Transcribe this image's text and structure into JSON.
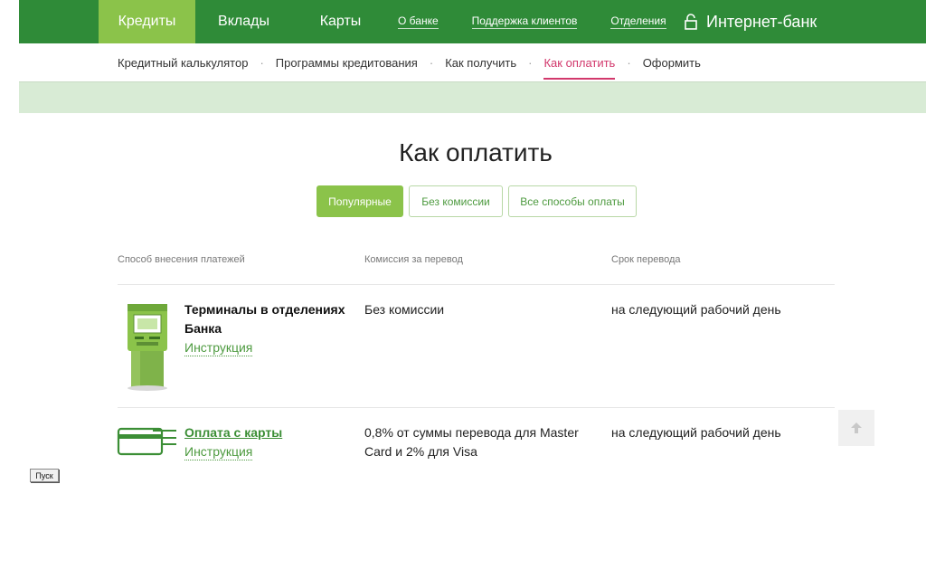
{
  "header": {
    "tabs": [
      {
        "label": "Кредиты",
        "active": true
      },
      {
        "label": "Вклады",
        "active": false
      },
      {
        "label": "Карты",
        "active": false
      }
    ],
    "links": [
      "О банке",
      "Поддержка клиентов",
      "Отделения"
    ],
    "internet_bank": "Интернет-банк",
    "bg_color": "#2f8b38",
    "accent": "#8bc34a"
  },
  "subnav": {
    "items": [
      "Кредитный калькулятор",
      "Программы кредитования",
      "Как получить",
      "Как оплатить",
      "Оформить"
    ],
    "separator": "·",
    "active_index": 3,
    "active_color": "#d2386c"
  },
  "page_title": "Как оплатить",
  "filters": [
    {
      "label": "Популярные",
      "active": true
    },
    {
      "label": "Без комиссии",
      "active": false
    },
    {
      "label": "Все способы оплаты",
      "active": false
    }
  ],
  "table": {
    "headers": [
      "Способ внесения платежей",
      "Комиссия за перевод",
      "Срок перевода"
    ],
    "rows": [
      {
        "icon": "atm-terminal-icon",
        "method_line1": "Терминалы в отделениях",
        "method_line2": "Банка",
        "instruction": "Инструкция",
        "commission_line1": "Без комиссии",
        "commission_line2": "",
        "term": "на следующий рабочий день"
      },
      {
        "icon": "bank-card-icon",
        "method_line1": "Оплата с карты",
        "method_line2": "",
        "instruction": "Инструкция",
        "commission_line1": "0,8% от суммы перевода для Master",
        "commission_line2": "Card и 2% для Visa",
        "term": "на следующий рабочий день"
      }
    ]
  },
  "taskbar": {
    "start_label": "Пуск"
  }
}
